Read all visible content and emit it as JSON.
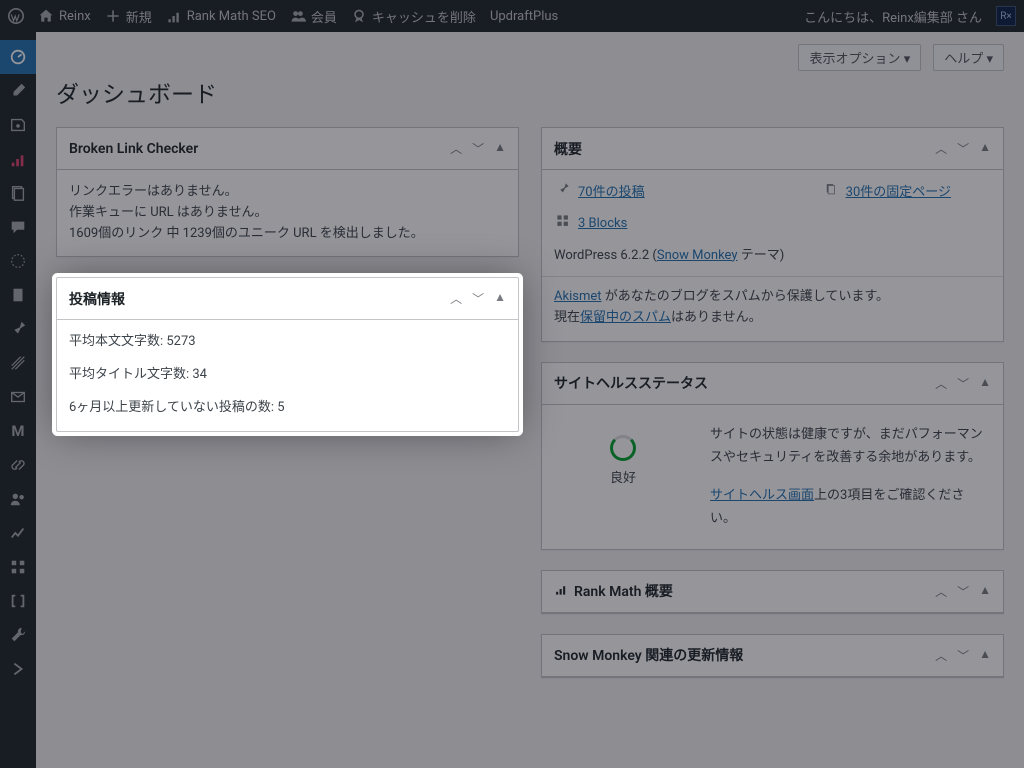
{
  "adminbar": {
    "site_name": "Reinx",
    "new": "新規",
    "seo": "Rank Math SEO",
    "members": "会員",
    "cache": "キャッシュを削除",
    "updraft": "UpdraftPlus",
    "greeting": "こんにちは、Reinx編集部 さん",
    "avatar_initials": "R×"
  },
  "screen_options": "表示オプション ▾",
  "help": "ヘルプ ▾",
  "page_title": "ダッシュボード",
  "blc": {
    "title": "Broken Link Checker",
    "line1": "リンクエラーはありません。",
    "line2": "作業キューに URL はありません。",
    "line3": "1609個のリンク 中 1239個のユニーク URL を検出しました。"
  },
  "postinfo": {
    "title": "投稿情報",
    "avg_body": "平均本文文字数: 5273",
    "avg_title": "平均タイトル文字数: 34",
    "stale": "6ヶ月以上更新していない投稿の数: 5"
  },
  "rightnow": {
    "title": "概要",
    "posts": "70件の投稿",
    "pages": "30件の固定ページ",
    "blocks": "3 Blocks",
    "wp_prefix": "WordPress 6.2.2 (",
    "theme_link": "Snow Monkey",
    "theme_suffix": " テーマ)",
    "akismet_link": "Akismet",
    "akismet_text": " があなたのブログをスパムから保護しています。",
    "spam_prefix": "現在",
    "spam_link": "保留中のスパム",
    "spam_suffix": "はありません。"
  },
  "sitehealth": {
    "title": "サイトヘルスステータス",
    "status": "良好",
    "desc": "サイトの状態は健康ですが、まだパフォーマンスやセキュリティを改善する余地があります。",
    "link": "サイトヘルス画面",
    "link_suffix": "上の3項目をご確認ください。"
  },
  "rankmath": {
    "title": "Rank Math 概要"
  },
  "snowmonkey": {
    "title": "Snow Monkey 関連の更新情報"
  }
}
